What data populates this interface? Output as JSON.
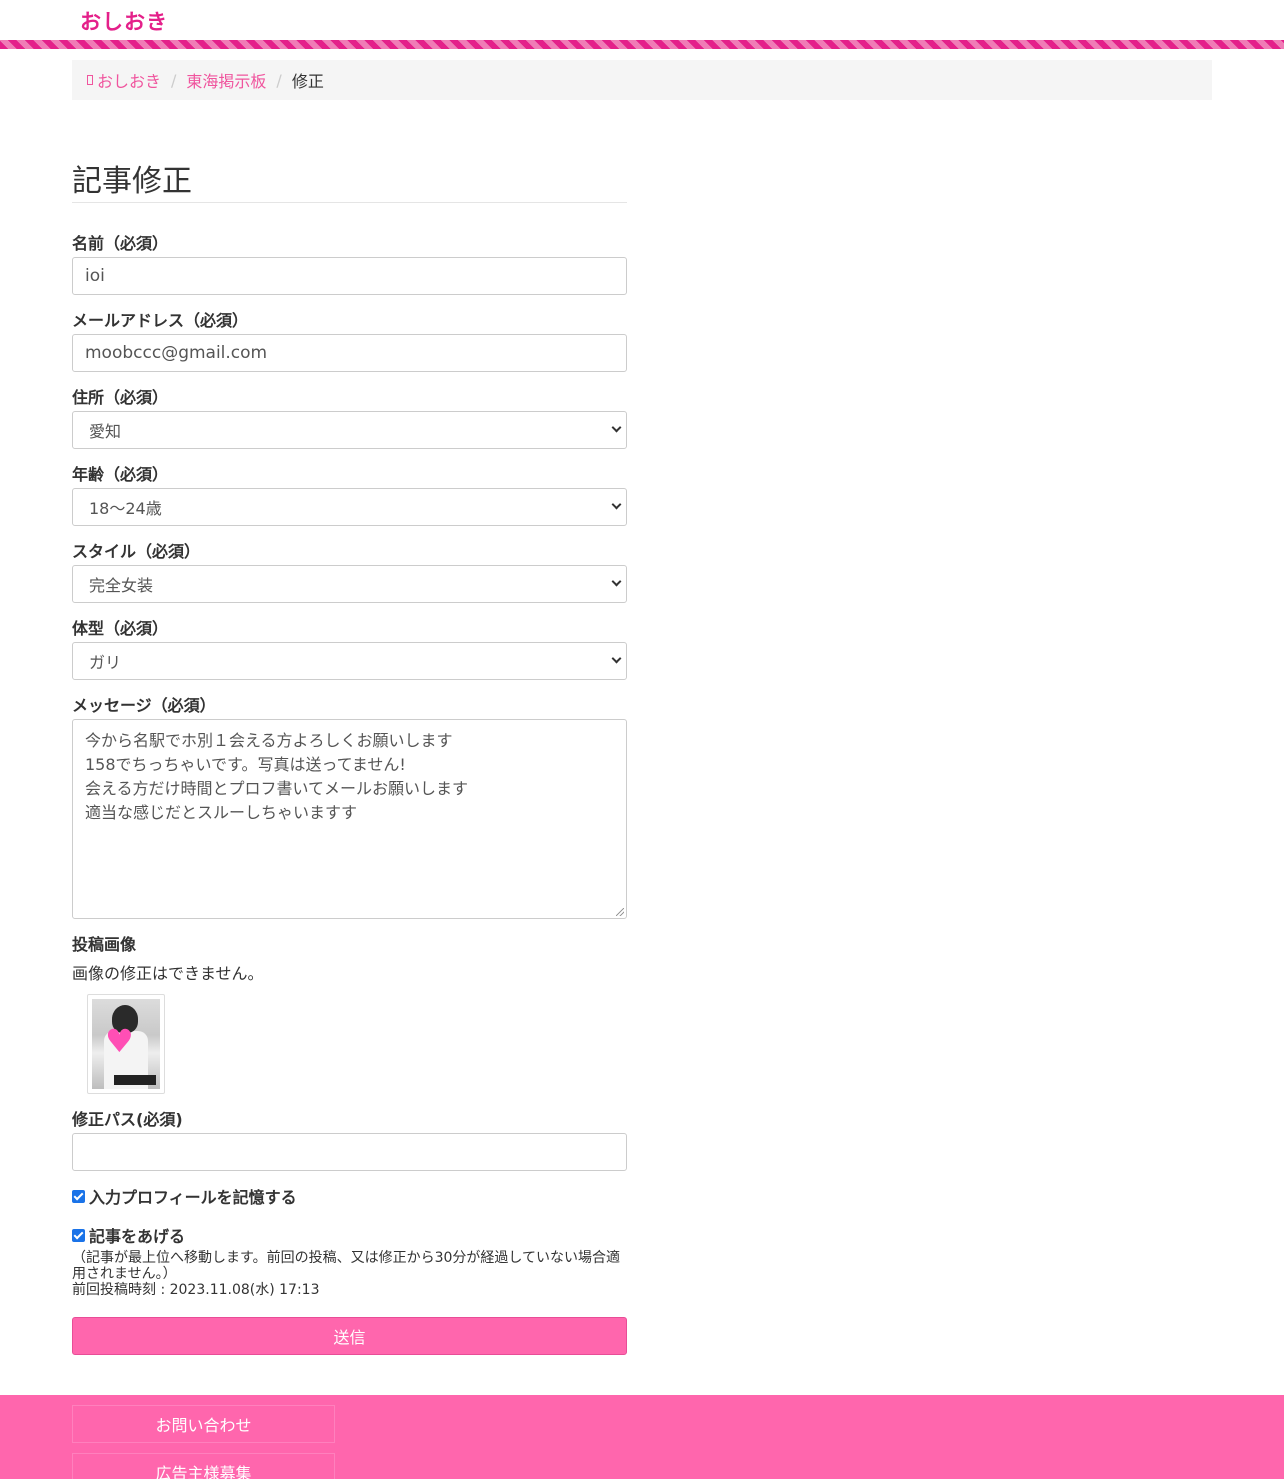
{
  "header": {
    "logo": "おしおき"
  },
  "breadcrumb": {
    "home": "おしおき",
    "board": "東海掲示板",
    "current": "修正",
    "separator": "/"
  },
  "form": {
    "title": "記事修正",
    "name_label": "名前（必須）",
    "name_value": "ioi",
    "email_label": "メールアドレス（必須）",
    "email_value": "moobccc@gmail.com",
    "address_label": "住所（必須）",
    "address_value": "愛知",
    "age_label": "年齢（必須）",
    "age_value": "18〜24歳",
    "style_label": "スタイル（必須）",
    "style_value": "完全女装",
    "body_label": "体型（必須）",
    "body_value": "ガリ",
    "message_label": "メッセージ（必須）",
    "message_lines": [
      "今から名駅でホ別１会える方よろしくお願いします",
      "158でちっちゃいです。写真は送ってません!",
      "会える方だけ時間とプロフ書いてメールお願いします",
      "適当な感じだとスルーしちゃいますす"
    ],
    "image_label": "投稿画像",
    "image_note": "画像の修正はできません。",
    "password_label": "修正パス(必須)",
    "password_value": "",
    "remember_label": "入力プロフィールを記憶する",
    "remember_checked": true,
    "bump_label": "記事をあげる",
    "bump_checked": true,
    "bump_note": "（記事が最上位へ移動します。前回の投稿、又は修正から30分が経過していない場合適用されません。）",
    "last_post": "前回投稿時刻 : 2023.11.08(水) 17:13",
    "submit_label": "送信"
  },
  "footer": {
    "contact": "お問い合わせ",
    "advertisers": "広告主様募集"
  },
  "colors": {
    "brand": "#e4208a",
    "button": "#ff66ad",
    "link": "#f0559e"
  }
}
